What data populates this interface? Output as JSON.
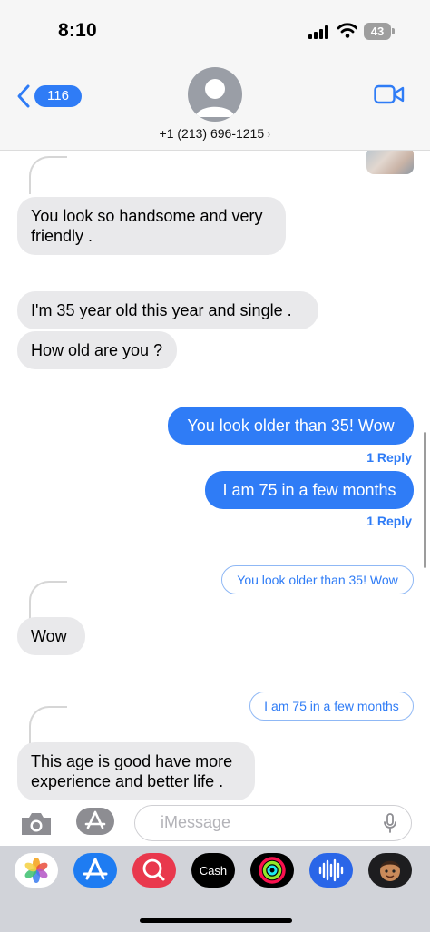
{
  "status_bar": {
    "time": "8:10",
    "battery": "43"
  },
  "header": {
    "back_count": "116",
    "contact": "+1 (213) 696-1215",
    "contact_chevron": "›"
  },
  "thread": {
    "messages": [
      {
        "text": "You look so handsome and very friendly ."
      },
      {
        "text": "I'm 35 year old this year and single ."
      },
      {
        "text": "How old are you ?"
      },
      {
        "text": "You look older than 35! Wow"
      },
      {
        "text": "1 Reply"
      },
      {
        "text": "I am 75 in a few months"
      },
      {
        "text": "1 Reply"
      },
      {
        "text": "You look older than 35! Wow"
      },
      {
        "text": "Wow"
      },
      {
        "text": "I am 75 in a few months"
      },
      {
        "text": "This age is good have more experience and better life ."
      }
    ]
  },
  "input": {
    "placeholder": "iMessage"
  },
  "drawer": {
    "apps": [
      {
        "icon": "photos-icon"
      },
      {
        "icon": "app-store-icon"
      },
      {
        "icon": "images-search-icon"
      },
      {
        "icon": "apple-cash-icon",
        "label": "Cash"
      },
      {
        "icon": "fitness-icon"
      },
      {
        "icon": "audio-message-icon"
      },
      {
        "icon": "memoji-icon"
      }
    ]
  },
  "colors": {
    "accent": "#2f7cf6",
    "incoming_bubble": "#e9e9eb",
    "bar_background": "#f6f6f6",
    "drawer_background": "#d1d3d9"
  }
}
